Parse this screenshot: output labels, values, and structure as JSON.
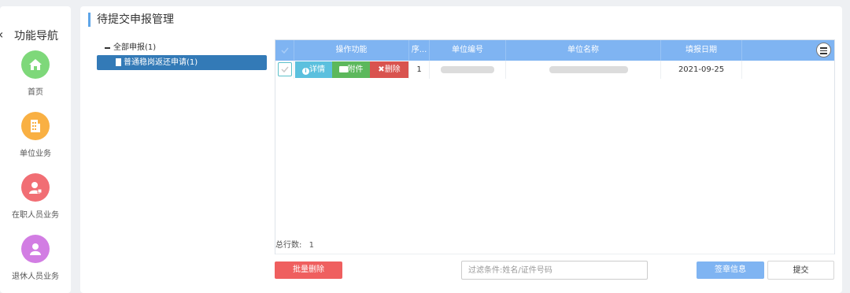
{
  "nav": {
    "collapse_glyph": "‹",
    "title": "功能导航",
    "items": [
      {
        "label": "首页",
        "icon": "home-icon",
        "color": "#7ed87a"
      },
      {
        "label": "单位业务",
        "icon": "document-icon",
        "color": "#f9b043"
      },
      {
        "label": "在职人员业务",
        "icon": "person-icon",
        "color": "#f16e74"
      },
      {
        "label": "退休人员业务",
        "icon": "person-icon",
        "color": "#d27de3"
      }
    ]
  },
  "main": {
    "title": "待提交申报管理",
    "tree": {
      "root": "全部申报(1)",
      "leaf": "普通稳岗返还申请(1)"
    },
    "grid": {
      "columns": [
        "操作功能",
        "序...",
        "单位编号",
        "单位名称",
        "填报日期"
      ],
      "row": {
        "actions": [
          "详情",
          "附件",
          "删除"
        ],
        "seq": "1",
        "date": "2021-09-25"
      },
      "total_label": "总行数:",
      "total_value": "1"
    },
    "buttons": {
      "batch_delete": "批量删除",
      "sign_info": "签章信息",
      "submit": "提交"
    },
    "search_placeholder": "过滤条件:姓名/证件号码",
    "colors": {
      "accent": "#7fb4f2",
      "tree_selected": "#337ab7",
      "details": "#5bc0de",
      "attachment": "#5cb85c",
      "delete": "#d9534f",
      "batch_delete": "#ef5f5f",
      "sign_info": "#7fb4f2"
    }
  }
}
